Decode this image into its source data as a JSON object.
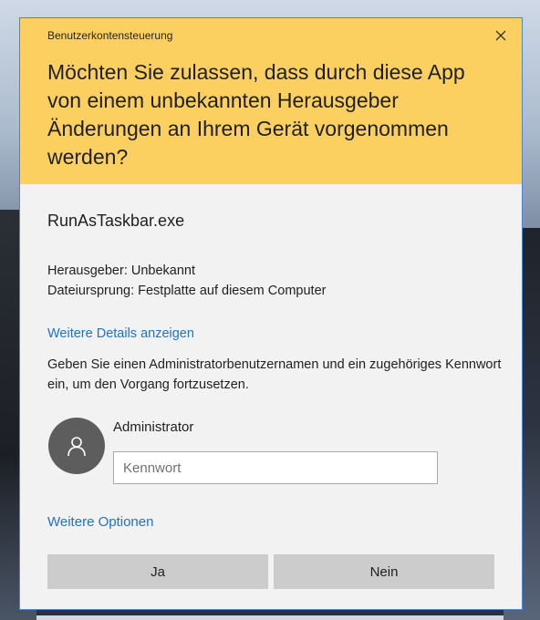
{
  "dialog": {
    "title": "Benutzerkontensteuerung",
    "question": "Möchten Sie zulassen, dass durch diese App von einem unbekannten Herausgeber Änderungen an Ihrem Gerät vorgenommen werden?",
    "app_name": "RunAsTaskbar.exe",
    "publisher_line": "Herausgeber: Unbekannt",
    "origin_line": "Dateiursprung: Festplatte auf diesem Computer",
    "details_link": "Weitere Details anzeigen",
    "instructions": "Geben Sie einen Administratorbenutzernamen und ein zugehöriges Kennwort ein, um den Vorgang fortzusetzen.",
    "more_options_link": "Weitere Optionen",
    "header_color": "#fcd060",
    "link_color": "#1e73c7"
  },
  "credentials": {
    "user_name": "Administrator",
    "password_placeholder": "Kennwort",
    "password_value": ""
  },
  "buttons": {
    "yes_label": "Ja",
    "no_label": "Nein"
  },
  "icons": {
    "close": "close-icon",
    "user": "user-icon"
  }
}
